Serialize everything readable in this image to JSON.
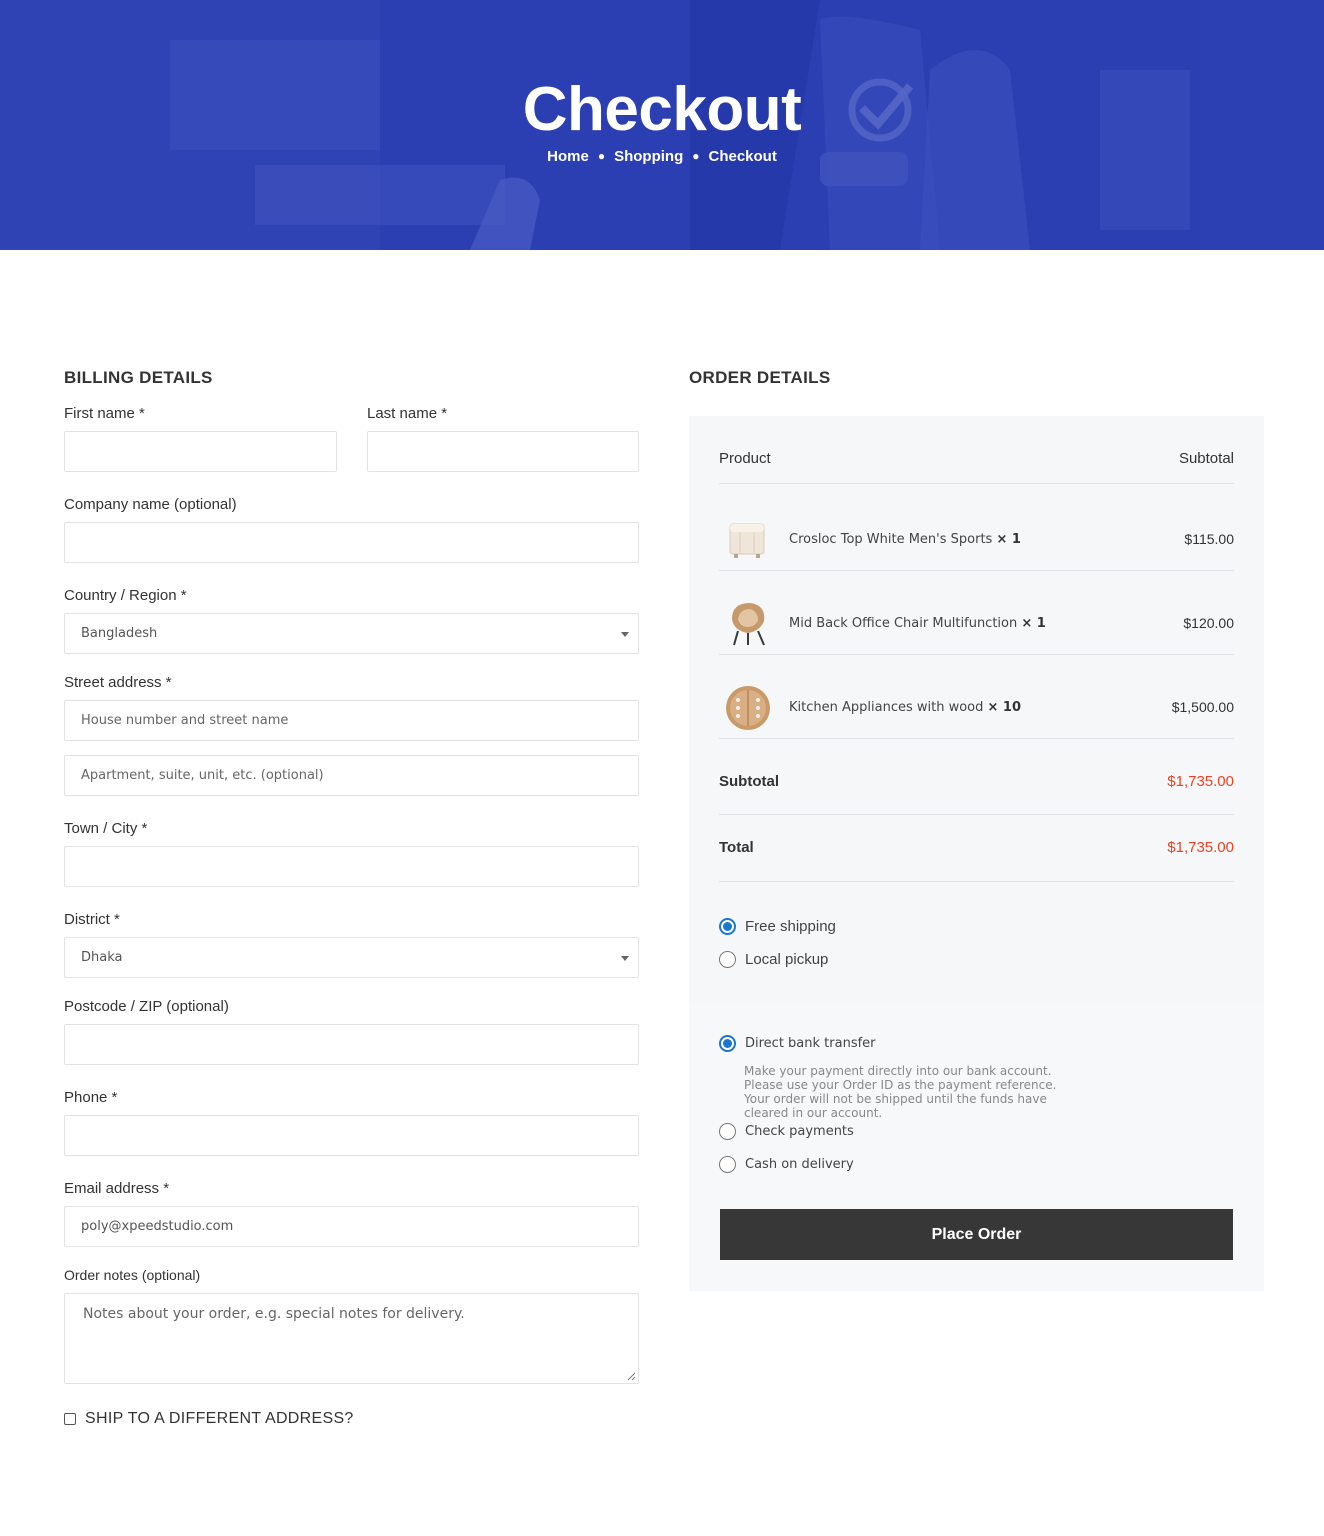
{
  "hero": {
    "title": "Checkout",
    "breadcrumb": [
      "Home",
      "Shopping",
      "Checkout"
    ]
  },
  "billing": {
    "title": "BILLING DETAILS",
    "first_name_label": "First name *",
    "last_name_label": "Last name *",
    "company_label": "Company name (optional)",
    "country_label": "Country / Region *",
    "country_value": "Bangladesh",
    "street_label": "Street address *",
    "street_placeholder": "House number and street name",
    "apartment_placeholder": "Apartment, suite, unit, etc. (optional)",
    "city_label": "Town / City *",
    "district_label": "District *",
    "district_value": "Dhaka",
    "postcode_label": "Postcode / ZIP (optional)",
    "phone_label": "Phone *",
    "email_label": "Email address *",
    "email_value": "poly@xpeedstudio.com",
    "notes_label": "Order notes (optional)",
    "notes_placeholder": "Notes about your order, e.g. special notes for delivery.",
    "ship_different_label": "SHIP TO A DIFFERENT ADDRESS?"
  },
  "order": {
    "title": "ORDER DETAILS",
    "col_product": "Product",
    "col_subtotal": "Subtotal",
    "items": [
      {
        "name": "Crosloc Top White Men's Sports",
        "qty": "× 1",
        "price": "$115.00"
      },
      {
        "name": "Mid Back Office Chair Multifunction",
        "qty": "× 1",
        "price": "$120.00"
      },
      {
        "name": "Kitchen Appliances with wood",
        "qty": "× 10",
        "price": "$1,500.00"
      }
    ],
    "subtotal_label": "Subtotal",
    "subtotal_value": "$1,735.00",
    "total_label": "Total",
    "total_value": "$1,735.00",
    "shipping_options": [
      "Free shipping",
      "Local pickup"
    ],
    "payment": {
      "bank_label": "Direct bank transfer",
      "bank_description": "Make your payment directly into our bank account. Please use your Order ID as the payment reference. Your order will not be shipped until the funds have cleared in our account.",
      "check_label": "Check payments",
      "cod_label": "Cash on delivery"
    },
    "place_order_label": "Place Order"
  },
  "colors": {
    "hero_blue": "#2a3eb1",
    "price_red": "#ef4123",
    "radio_blue": "#1976d2",
    "button_dark": "#373737"
  }
}
